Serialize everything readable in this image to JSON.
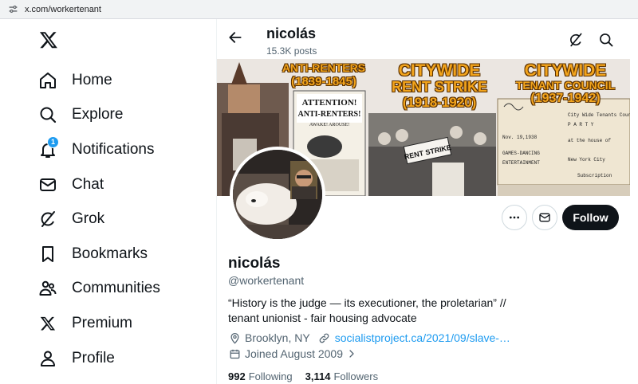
{
  "browser": {
    "url": "x.com/workertenant"
  },
  "sidebar": {
    "items": [
      {
        "label": "Home",
        "icon": "home-icon"
      },
      {
        "label": "Explore",
        "icon": "search-icon"
      },
      {
        "label": "Notifications",
        "icon": "bell-icon",
        "badge": "1"
      },
      {
        "label": "Chat",
        "icon": "mail-icon"
      },
      {
        "label": "Grok",
        "icon": "grok-icon"
      },
      {
        "label": "Bookmarks",
        "icon": "bookmark-icon"
      },
      {
        "label": "Communities",
        "icon": "communities-icon"
      },
      {
        "label": "Premium",
        "icon": "x-logo-icon"
      },
      {
        "label": "Profile",
        "icon": "person-icon"
      }
    ]
  },
  "header": {
    "name": "nicolás",
    "posts": "15.3K posts"
  },
  "banner": {
    "h1": "ANTI-RENTERS",
    "h1_years": "(1839-1845)",
    "h2": "CITYWIDE",
    "h2_sub": "RENT STRIKE",
    "h2_years": "(1918-1920)",
    "h3": "CITYWIDE",
    "h3_sub": "TENANT COUNCIL",
    "h3_years": "(1937-1942)"
  },
  "actions": {
    "follow": "Follow"
  },
  "profile": {
    "display_name": "nicolás",
    "handle": "@workertenant",
    "bio": "“History is the judge — its executioner, the proletarian” // tenant unionist - fair housing advocate",
    "location": "Brooklyn, NY",
    "website": "socialistproject.ca/2021/09/slave-…",
    "joined": "Joined August 2009",
    "following_count": "992",
    "following_label": "Following",
    "followers_count": "3,114",
    "followers_label": "Followers"
  },
  "colors": {
    "accent": "#1d9bf0",
    "text": "#0f1419",
    "muted": "#536471",
    "banner_title": "#f2a41c"
  }
}
